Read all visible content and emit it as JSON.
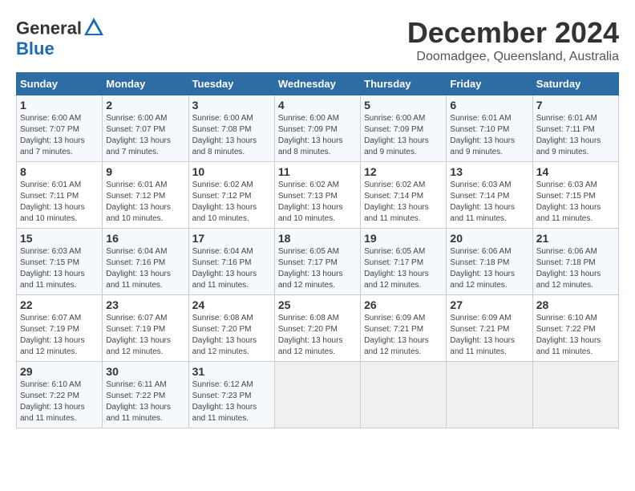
{
  "logo": {
    "general": "General",
    "blue": "Blue"
  },
  "header": {
    "month": "December 2024",
    "location": "Doomadgee, Queensland, Australia"
  },
  "weekdays": [
    "Sunday",
    "Monday",
    "Tuesday",
    "Wednesday",
    "Thursday",
    "Friday",
    "Saturday"
  ],
  "weeks": [
    [
      {
        "day": "1",
        "sunrise": "6:00 AM",
        "sunset": "7:07 PM",
        "daylight": "13 hours and 7 minutes."
      },
      {
        "day": "2",
        "sunrise": "6:00 AM",
        "sunset": "7:07 PM",
        "daylight": "13 hours and 7 minutes."
      },
      {
        "day": "3",
        "sunrise": "6:00 AM",
        "sunset": "7:08 PM",
        "daylight": "13 hours and 8 minutes."
      },
      {
        "day": "4",
        "sunrise": "6:00 AM",
        "sunset": "7:09 PM",
        "daylight": "13 hours and 8 minutes."
      },
      {
        "day": "5",
        "sunrise": "6:00 AM",
        "sunset": "7:09 PM",
        "daylight": "13 hours and 9 minutes."
      },
      {
        "day": "6",
        "sunrise": "6:01 AM",
        "sunset": "7:10 PM",
        "daylight": "13 hours and 9 minutes."
      },
      {
        "day": "7",
        "sunrise": "6:01 AM",
        "sunset": "7:11 PM",
        "daylight": "13 hours and 9 minutes."
      }
    ],
    [
      {
        "day": "8",
        "sunrise": "6:01 AM",
        "sunset": "7:11 PM",
        "daylight": "13 hours and 10 minutes."
      },
      {
        "day": "9",
        "sunrise": "6:01 AM",
        "sunset": "7:12 PM",
        "daylight": "13 hours and 10 minutes."
      },
      {
        "day": "10",
        "sunrise": "6:02 AM",
        "sunset": "7:12 PM",
        "daylight": "13 hours and 10 minutes."
      },
      {
        "day": "11",
        "sunrise": "6:02 AM",
        "sunset": "7:13 PM",
        "daylight": "13 hours and 10 minutes."
      },
      {
        "day": "12",
        "sunrise": "6:02 AM",
        "sunset": "7:14 PM",
        "daylight": "13 hours and 11 minutes."
      },
      {
        "day": "13",
        "sunrise": "6:03 AM",
        "sunset": "7:14 PM",
        "daylight": "13 hours and 11 minutes."
      },
      {
        "day": "14",
        "sunrise": "6:03 AM",
        "sunset": "7:15 PM",
        "daylight": "13 hours and 11 minutes."
      }
    ],
    [
      {
        "day": "15",
        "sunrise": "6:03 AM",
        "sunset": "7:15 PM",
        "daylight": "13 hours and 11 minutes."
      },
      {
        "day": "16",
        "sunrise": "6:04 AM",
        "sunset": "7:16 PM",
        "daylight": "13 hours and 11 minutes."
      },
      {
        "day": "17",
        "sunrise": "6:04 AM",
        "sunset": "7:16 PM",
        "daylight": "13 hours and 11 minutes."
      },
      {
        "day": "18",
        "sunrise": "6:05 AM",
        "sunset": "7:17 PM",
        "daylight": "13 hours and 12 minutes."
      },
      {
        "day": "19",
        "sunrise": "6:05 AM",
        "sunset": "7:17 PM",
        "daylight": "13 hours and 12 minutes."
      },
      {
        "day": "20",
        "sunrise": "6:06 AM",
        "sunset": "7:18 PM",
        "daylight": "13 hours and 12 minutes."
      },
      {
        "day": "21",
        "sunrise": "6:06 AM",
        "sunset": "7:18 PM",
        "daylight": "13 hours and 12 minutes."
      }
    ],
    [
      {
        "day": "22",
        "sunrise": "6:07 AM",
        "sunset": "7:19 PM",
        "daylight": "13 hours and 12 minutes."
      },
      {
        "day": "23",
        "sunrise": "6:07 AM",
        "sunset": "7:19 PM",
        "daylight": "13 hours and 12 minutes."
      },
      {
        "day": "24",
        "sunrise": "6:08 AM",
        "sunset": "7:20 PM",
        "daylight": "13 hours and 12 minutes."
      },
      {
        "day": "25",
        "sunrise": "6:08 AM",
        "sunset": "7:20 PM",
        "daylight": "13 hours and 12 minutes."
      },
      {
        "day": "26",
        "sunrise": "6:09 AM",
        "sunset": "7:21 PM",
        "daylight": "13 hours and 12 minutes."
      },
      {
        "day": "27",
        "sunrise": "6:09 AM",
        "sunset": "7:21 PM",
        "daylight": "13 hours and 11 minutes."
      },
      {
        "day": "28",
        "sunrise": "6:10 AM",
        "sunset": "7:22 PM",
        "daylight": "13 hours and 11 minutes."
      }
    ],
    [
      {
        "day": "29",
        "sunrise": "6:10 AM",
        "sunset": "7:22 PM",
        "daylight": "13 hours and 11 minutes."
      },
      {
        "day": "30",
        "sunrise": "6:11 AM",
        "sunset": "7:22 PM",
        "daylight": "13 hours and 11 minutes."
      },
      {
        "day": "31",
        "sunrise": "6:12 AM",
        "sunset": "7:23 PM",
        "daylight": "13 hours and 11 minutes."
      },
      null,
      null,
      null,
      null
    ]
  ]
}
